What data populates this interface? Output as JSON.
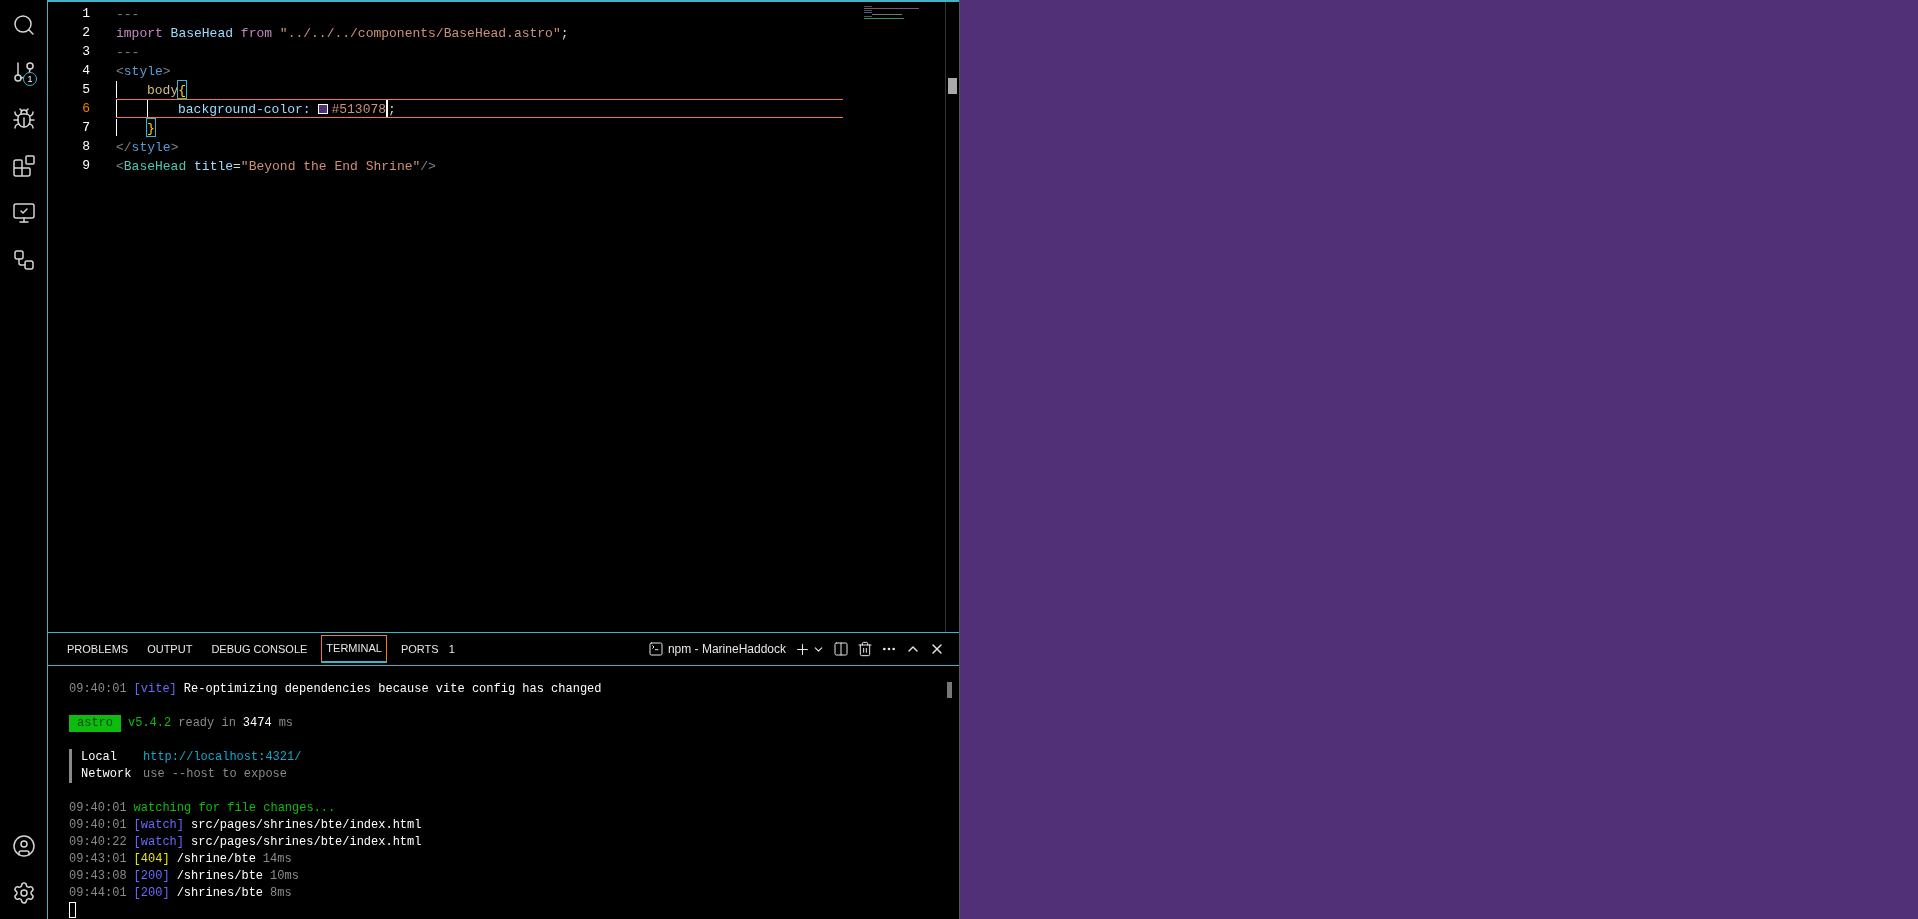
{
  "activity_bar": {
    "items": [
      {
        "kind": "search"
      },
      {
        "kind": "source-control",
        "badge": "1"
      },
      {
        "kind": "run-debug"
      },
      {
        "kind": "extensions"
      },
      {
        "kind": "remote"
      },
      {
        "kind": "graph"
      }
    ],
    "bottom": [
      {
        "kind": "account"
      },
      {
        "kind": "settings"
      }
    ]
  },
  "editor": {
    "lines": [
      {
        "number": "1",
        "current": false,
        "tokens": [
          {
            "kind": "dim",
            "text": "---"
          }
        ]
      },
      {
        "number": "2",
        "current": false,
        "tokens": [
          {
            "kind": "keyword",
            "text": "import "
          },
          {
            "kind": "ident",
            "text": "BaseHead "
          },
          {
            "kind": "keyword",
            "text": "from "
          },
          {
            "kind": "string",
            "text": "\"../../../components/BaseHead.astro\""
          },
          {
            "kind": "plain",
            "text": ";"
          }
        ]
      },
      {
        "number": "3",
        "current": false,
        "tokens": [
          {
            "kind": "dim",
            "text": "---"
          }
        ]
      },
      {
        "number": "4",
        "current": false,
        "tokens": [
          {
            "kind": "dim",
            "text": "<"
          },
          {
            "kind": "tag",
            "text": "style"
          },
          {
            "kind": "dim",
            "text": ">"
          }
        ],
        "children": [
          {
            "number": "5",
            "current": false,
            "tokens": [
              {
                "kind": "selector",
                "text": "body"
              },
              {
                "kind": "brace",
                "text": "{"
              }
            ],
            "children": [
              {
                "number": "6",
                "current": true,
                "tokens": [
                  {
                    "kind": "ident",
                    "text": "background-color: "
                  },
                  {
                    "kind": "swatch",
                    "color": "#513078"
                  },
                  {
                    "kind": "string",
                    "text": "#513078"
                  },
                  {
                    "kind": "cursor"
                  },
                  {
                    "kind": "plain",
                    "text": ";"
                  }
                ]
              }
            ]
          },
          {
            "number": "7",
            "current": false,
            "tokens": [
              {
                "kind": "brace",
                "text": "}"
              }
            ]
          }
        ]
      },
      {
        "number": "8",
        "current": false,
        "tokens": [
          {
            "kind": "dim",
            "text": "</"
          },
          {
            "kind": "tag",
            "text": "style"
          },
          {
            "kind": "dim",
            "text": ">"
          }
        ]
      },
      {
        "number": "9",
        "current": false,
        "tokens": [
          {
            "kind": "dim",
            "text": "<"
          },
          {
            "kind": "component",
            "text": "BaseHead "
          },
          {
            "kind": "ident",
            "text": "title"
          },
          {
            "kind": "plain",
            "text": "="
          },
          {
            "kind": "string",
            "text": "\"Beyond the End Shrine\""
          },
          {
            "kind": "dim",
            "text": "/>"
          }
        ]
      }
    ]
  },
  "panel": {
    "tabs": [
      {
        "label": "PROBLEMS",
        "selected": false
      },
      {
        "label": "OUTPUT",
        "selected": false
      },
      {
        "label": "DEBUG CONSOLE",
        "selected": false
      },
      {
        "label": "TERMINAL",
        "selected": true
      },
      {
        "label": "PORTS",
        "selected": false,
        "count": "1"
      }
    ],
    "terminal_name": "npm - MarineHaddock"
  },
  "terminal": {
    "lines": [
      {
        "kind": "line",
        "segments": [
          {
            "kind": "time",
            "text": "09:40:01"
          },
          {
            "kind": "blue",
            "text": "[vite]"
          },
          {
            "kind": "text",
            "text": "Re-optimizing dependencies because vite config has changed"
          }
        ]
      },
      {
        "kind": "blank"
      },
      {
        "kind": "line",
        "segments": [
          {
            "kind": "badge",
            "text": "astro"
          },
          {
            "kind": "green",
            "text": "v5.4.2"
          },
          {
            "kind": "dim",
            "text": "ready in"
          },
          {
            "kind": "text",
            "text": "3474"
          },
          {
            "kind": "dim",
            "text": "ms"
          }
        ]
      },
      {
        "kind": "blank"
      },
      {
        "kind": "line",
        "segments": [
          {
            "kind": "bar"
          },
          {
            "kind": "label",
            "text": "Local"
          },
          {
            "kind": "cyan",
            "text": "http://localhost:4321/"
          }
        ]
      },
      {
        "kind": "line",
        "segments": [
          {
            "kind": "bar"
          },
          {
            "kind": "label",
            "text": "Network"
          },
          {
            "kind": "dim",
            "text": "use --host to expose"
          }
        ]
      },
      {
        "kind": "blank"
      },
      {
        "kind": "line",
        "segments": [
          {
            "kind": "time",
            "text": "09:40:01"
          },
          {
            "kind": "green",
            "text": "watching for file changes..."
          }
        ]
      },
      {
        "kind": "line",
        "segments": [
          {
            "kind": "time",
            "text": "09:40:01"
          },
          {
            "kind": "blue",
            "text": "[watch]"
          },
          {
            "kind": "text",
            "text": "src/pages/shrines/bte/index.html"
          }
        ]
      },
      {
        "kind": "line",
        "segments": [
          {
            "kind": "time",
            "text": "09:40:22"
          },
          {
            "kind": "blue",
            "text": "[watch]"
          },
          {
            "kind": "text",
            "text": "src/pages/shrines/bte/index.html"
          }
        ]
      },
      {
        "kind": "line",
        "segments": [
          {
            "kind": "time",
            "text": "09:43:01"
          },
          {
            "kind": "yellow",
            "text": "[404]"
          },
          {
            "kind": "text",
            "text": "/shrine/bte"
          },
          {
            "kind": "dim",
            "text": "14ms"
          }
        ]
      },
      {
        "kind": "line",
        "segments": [
          {
            "kind": "time",
            "text": "09:43:08"
          },
          {
            "kind": "blue",
            "text": "[200]"
          },
          {
            "kind": "text",
            "text": "/shrines/bte"
          },
          {
            "kind": "dim",
            "text": "10ms"
          }
        ]
      },
      {
        "kind": "line",
        "segments": [
          {
            "kind": "time",
            "text": "09:44:01"
          },
          {
            "kind": "blue",
            "text": "[200]"
          },
          {
            "kind": "text",
            "text": "/shrines/bte"
          },
          {
            "kind": "dim",
            "text": "8ms"
          }
        ]
      },
      {
        "kind": "line",
        "segments": [
          {
            "kind": "cursor"
          }
        ]
      }
    ]
  }
}
